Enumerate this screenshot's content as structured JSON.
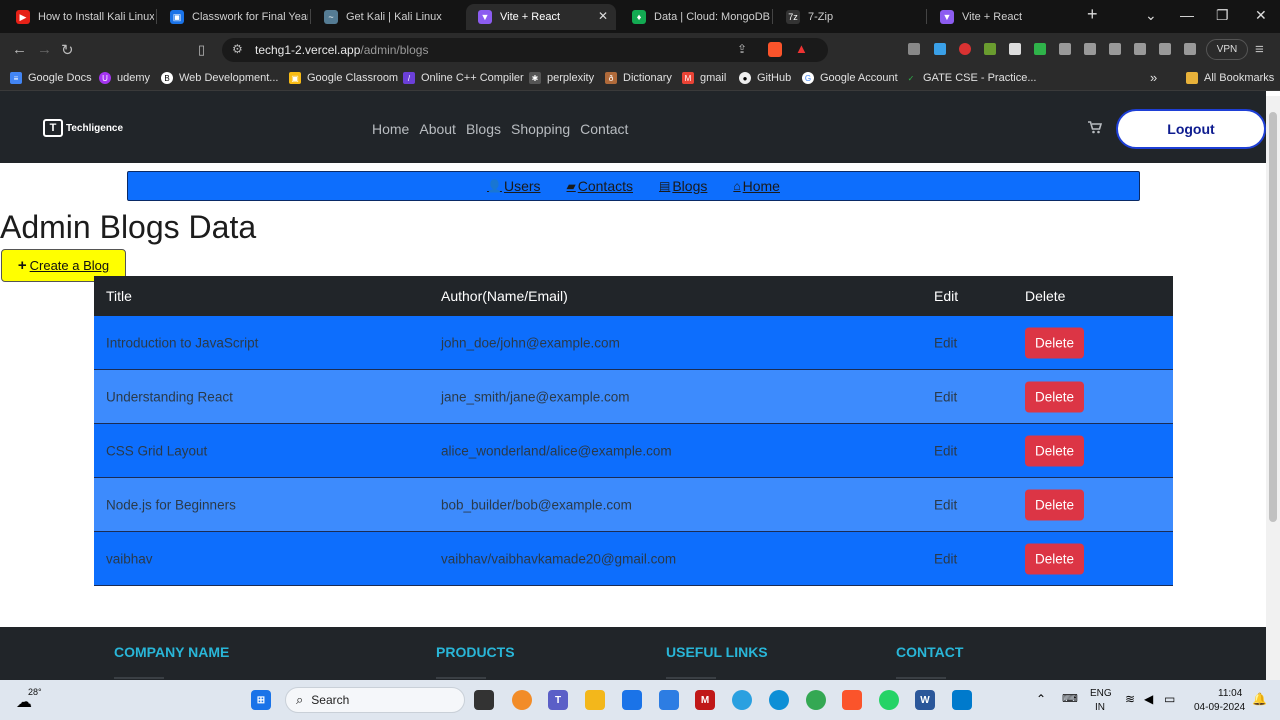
{
  "browser": {
    "tabs": [
      {
        "label": "How to Install Kali Linux",
        "icon_color": "#e62117"
      },
      {
        "label": "Classwork for Final Year C",
        "icon_color": "#1a73e8"
      },
      {
        "label": "Get Kali | Kali Linux",
        "icon_color": "#557c94"
      },
      {
        "label": "Vite + React",
        "icon_color": "#8c5cf0",
        "active": true
      },
      {
        "label": "Data | Cloud: MongoDB C",
        "icon_color": "#13aa52"
      },
      {
        "label": "7-Zip",
        "icon_color": "#333333"
      },
      {
        "label": "Vite + React",
        "icon_color": "#8c5cf0"
      }
    ],
    "new_tab_label": "+",
    "url_host": "techg1-2.vercel.app",
    "url_path": "/admin/blogs",
    "vpn_label": "VPN",
    "bookmarks": [
      "Google Docs",
      "udemy",
      "Web Development...",
      "Google Classroom",
      "Online C++ Compiler",
      "perplexity",
      "Dictionary",
      "gmail",
      "GitHub",
      "Google Account",
      "GATE CSE - Practice..."
    ],
    "all_bookmarks_label": "All Bookmarks"
  },
  "site": {
    "logo_text": "Techligence",
    "nav": [
      "Home",
      "About",
      "Blogs",
      "Shopping",
      "Contact"
    ],
    "logout_label": "Logout"
  },
  "admin_nav": {
    "users": "Users",
    "contacts": "Contacts",
    "blogs": "Blogs",
    "home": "Home"
  },
  "page_title": "Admin Blogs Data",
  "create_label": "Create a Blog",
  "table": {
    "headers": {
      "title": "Title",
      "author": "Author(Name/Email)",
      "edit": "Edit",
      "delete": "Delete"
    },
    "rows": [
      {
        "title": "Introduction to JavaScript",
        "author": "john_doe/john@example.com",
        "edit": "Edit",
        "delete": "Delete"
      },
      {
        "title": "Understanding React",
        "author": "jane_smith/jane@example.com",
        "edit": "Edit",
        "delete": "Delete"
      },
      {
        "title": "CSS Grid Layout",
        "author": "alice_wonderland/alice@example.com",
        "edit": "Edit",
        "delete": "Delete"
      },
      {
        "title": "Node.js for Beginners",
        "author": "bob_builder/bob@example.com",
        "edit": "Edit",
        "delete": "Delete"
      },
      {
        "title": "vaibhav",
        "author": "vaibhav/vaibhavkamade20@gmail.com",
        "edit": "Edit",
        "delete": "Delete"
      }
    ]
  },
  "footer": {
    "col1": "COMPANY NAME",
    "col2": "PRODUCTS",
    "col3": "USEFUL LINKS",
    "col4": "CONTACT"
  },
  "taskbar": {
    "weather": "28°",
    "search_placeholder": "Search",
    "lang_top": "ENG",
    "lang_bottom": "IN",
    "time": "11:04",
    "date": "04-09-2024"
  },
  "colors": {
    "header_bg": "#212529",
    "admin_nav_bg": "#0d6efd",
    "row_odd": "#0d6efd",
    "row_even": "#3d8bfd",
    "delete_btn": "#dc3545",
    "create_btn": "#ffff00",
    "footer_heading": "#29b6d8"
  }
}
